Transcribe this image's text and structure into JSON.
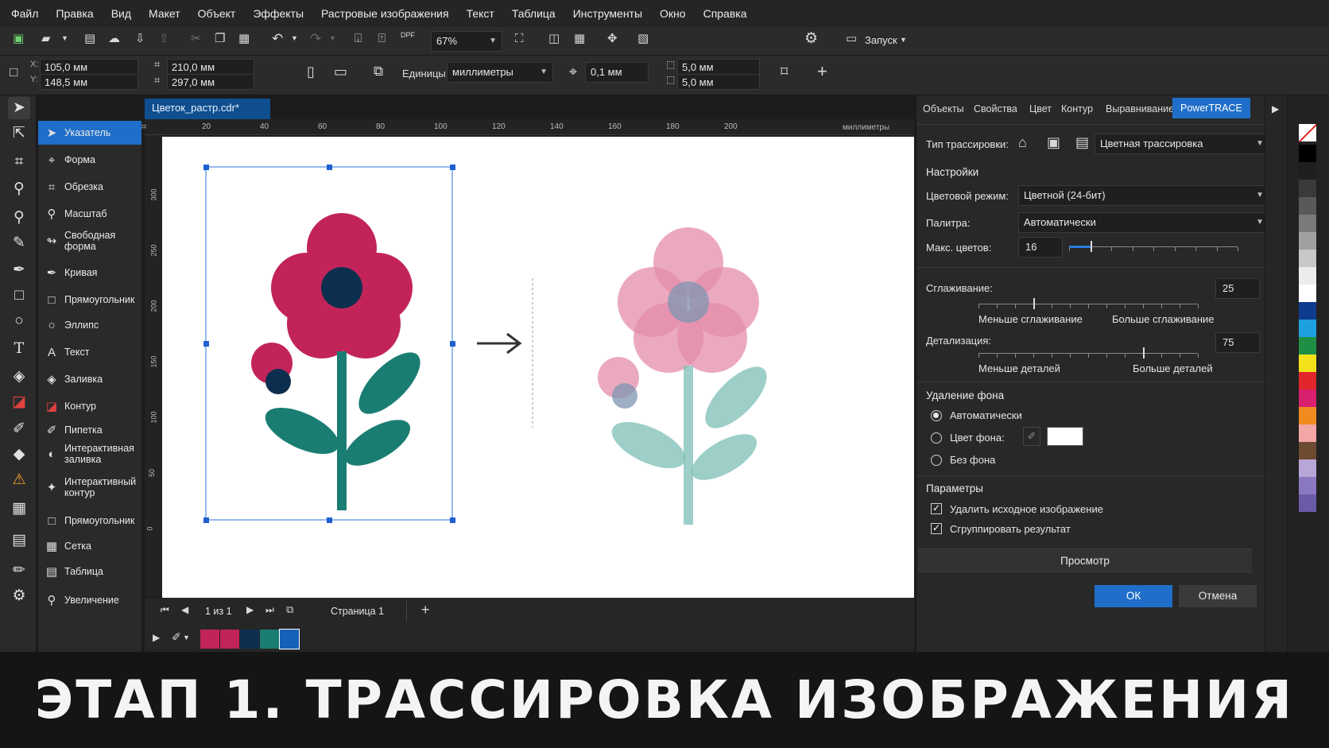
{
  "menu": [
    "Файл",
    "Правка",
    "Вид",
    "Макет",
    "Объект",
    "Эффекты",
    "Растровые изображения",
    "Текст",
    "Таблица",
    "Инструменты",
    "Окно",
    "Справка"
  ],
  "toolbar": {
    "zoom": "67%",
    "launch": "Запуск"
  },
  "propbar": {
    "x": "105,0 мм",
    "y": "148,5 мм",
    "w": "210,0 мм",
    "h": "297,0 мм",
    "units_label": "Единицы:",
    "units": "миллиметры",
    "nudge": "0,1 мм",
    "dup_x": "5,0 мм",
    "dup_y": "5,0 мм",
    "x_label": "X:",
    "y_label": "Y:"
  },
  "flyout": [
    {
      "label": "Указатель",
      "icon": "pointer-icon",
      "sel": true
    },
    {
      "label": "Форма",
      "icon": "shape-icon"
    },
    {
      "label": "Обрезка",
      "icon": "crop-icon"
    },
    {
      "label": "Масштаб",
      "icon": "zoom-icon"
    },
    {
      "label": "Свободная\nформа",
      "icon": "freehand-icon"
    },
    {
      "label": "Кривая",
      "icon": "curve-icon"
    },
    {
      "label": "Прямоугольник",
      "icon": "rectangle-icon"
    },
    {
      "label": "Эллипс",
      "icon": "ellipse-icon"
    },
    {
      "label": "Текст",
      "icon": "text-icon"
    },
    {
      "label": "Заливка",
      "icon": "fill-icon"
    },
    {
      "label": "Контур",
      "icon": "outline-icon"
    },
    {
      "label": "Пипетка",
      "icon": "eyedropper-icon"
    },
    {
      "label": "Интерактивная\nзаливка",
      "icon": "interactive-fill-icon"
    },
    {
      "label": "Интерактивный\nконтур",
      "icon": "interactive-outline-icon"
    },
    {
      "label": "Прямоугольник",
      "icon": "rectangle-icon"
    },
    {
      "label": "Сетка",
      "icon": "grid-icon"
    },
    {
      "label": "Таблица",
      "icon": "table-icon"
    },
    {
      "label": "Увеличение",
      "icon": "zoom-icon"
    }
  ],
  "doc": {
    "tab": "Цветок_растр.cdr*",
    "ruler_unit": "миллиметры",
    "ruler_ticks": [
      "20",
      "40",
      "60",
      "80",
      "100",
      "120",
      "140",
      "160",
      "180",
      "200"
    ],
    "vruler_ticks": [
      "300",
      "250",
      "200",
      "150",
      "100",
      "50",
      "0"
    ]
  },
  "pagebar": {
    "pages": "1 из 1",
    "page_name": "Страница 1"
  },
  "doc_palette": [
    "#c2245a",
    "#c2245a",
    "#0d2f4f",
    "#1a7d72",
    "#1560b8"
  ],
  "panel": {
    "tabs": [
      "Объекты",
      "Свойства",
      "Цвет",
      "Контур",
      "Выравнивание",
      "PowerTRACE"
    ],
    "trace_type_label": "Тип трассировки:",
    "trace_type": "Цветная трассировка",
    "settings": "Настройки",
    "color_mode_label": "Цветовой режим:",
    "color_mode": "Цветной (24-бит)",
    "palette_label": "Палитра:",
    "palette": "Автоматически",
    "max_colors_label": "Макс. цветов:",
    "max_colors": "16",
    "smoothing_label": "Сглаживание:",
    "smoothing": "25",
    "smoothing_min": "Меньше сглаживание",
    "smoothing_max": "Больше сглаживание",
    "detail_label": "Детализация:",
    "detail": "75",
    "detail_min": "Меньше деталей",
    "detail_max": "Больше деталей",
    "bg_removal": "Удаление фона",
    "bg_auto": "Автоматически",
    "bg_color": "Цвет фона:",
    "bg_none": "Без фона",
    "params": "Параметры",
    "delete_src": "Удалить исходное изображение",
    "group_result": "Сгруппировать результат",
    "preview": "Просмотр",
    "ok": "ОК",
    "cancel": "Отмена"
  },
  "color_palette": [
    "#000000",
    "#1e1e1e",
    "#3a3a3a",
    "#595959",
    "#7a7a7a",
    "#a0a0a0",
    "#c8c8c8",
    "#ececec",
    "#ffffff",
    "#0e3b8c",
    "#1ea0e0",
    "#1f8f45",
    "#f3e21a",
    "#e0262a",
    "#d8206f",
    "#f18a1f",
    "#f2a6a6",
    "#6d4a30",
    "#b9a6d8",
    "#8a78c0",
    "#6a5aa8"
  ],
  "caption": "ЭТАП 1. ТРАССИРОВКА ИЗОБРАЖЕНИЯ"
}
